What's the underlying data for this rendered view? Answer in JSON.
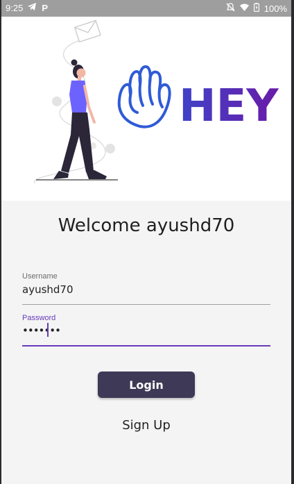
{
  "status_bar": {
    "time": "9:25",
    "battery": "100%",
    "icons": [
      "telegram-icon",
      "p-app-icon",
      "mute-icon",
      "wifi-icon",
      "battery-icon"
    ]
  },
  "hero": {
    "logo_text": "HEY",
    "illustration": "woman-walking-illustration"
  },
  "welcome_text": "Welcome ayushd70",
  "form": {
    "username_label": "Username",
    "username_value": "ayushd70",
    "password_label": "Password",
    "password_value": "•••••••"
  },
  "buttons": {
    "login": "Login",
    "signup": "Sign Up"
  },
  "colors": {
    "accent": "#673ab7",
    "button": "#3d3956",
    "logo_blue": "#2f5bd6",
    "logo_purple": "#6a1ba8"
  }
}
